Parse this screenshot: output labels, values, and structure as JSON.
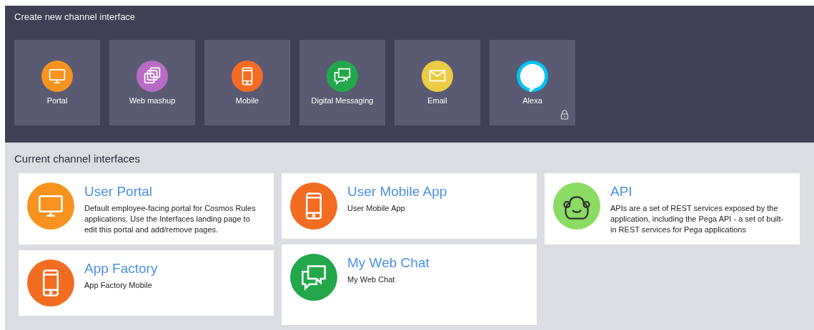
{
  "create_section": {
    "title": "Create new channel interface",
    "tiles": [
      {
        "label": "Portal",
        "kind": "monitor",
        "color": "#f7931e",
        "locked": false
      },
      {
        "label": "Web mashup",
        "kind": "layers",
        "color": "#b86cc4",
        "locked": false
      },
      {
        "label": "Mobile",
        "kind": "phone",
        "color": "#f26d21",
        "locked": false
      },
      {
        "label": "Digital Messaging",
        "kind": "chat",
        "color": "#22a84a",
        "locked": false
      },
      {
        "label": "Email",
        "kind": "mail",
        "color": "#eccb45",
        "locked": false
      },
      {
        "label": "Alexa",
        "kind": "alexa",
        "color": "#00c3f2",
        "locked": true
      }
    ]
  },
  "current_section": {
    "title": "Current channel interfaces",
    "columns": [
      [
        {
          "title": "User Portal",
          "description": "Default employee-facing portal for Cosmos Rules applications. Use the Interfaces landing page to edit this portal and add/remove pages.",
          "kind": "monitor",
          "color": "#f7931e"
        },
        {
          "title": "App Factory",
          "description": "App Factory Mobile",
          "kind": "phone",
          "color": "#f26d21"
        }
      ],
      [
        {
          "title": "User Mobile App",
          "description": "User Mobile App",
          "kind": "phone",
          "color": "#f26d21"
        },
        {
          "title": "My Web Chat",
          "description": "My Web Chat",
          "kind": "chat",
          "color": "#22a84a"
        }
      ],
      [
        {
          "title": "API",
          "description": "APIs are a set of REST services exposed by the application, including the Pega API - a set of built-in REST services for Pega applications",
          "kind": "monkey",
          "color": "#8cdc64"
        }
      ]
    ]
  }
}
